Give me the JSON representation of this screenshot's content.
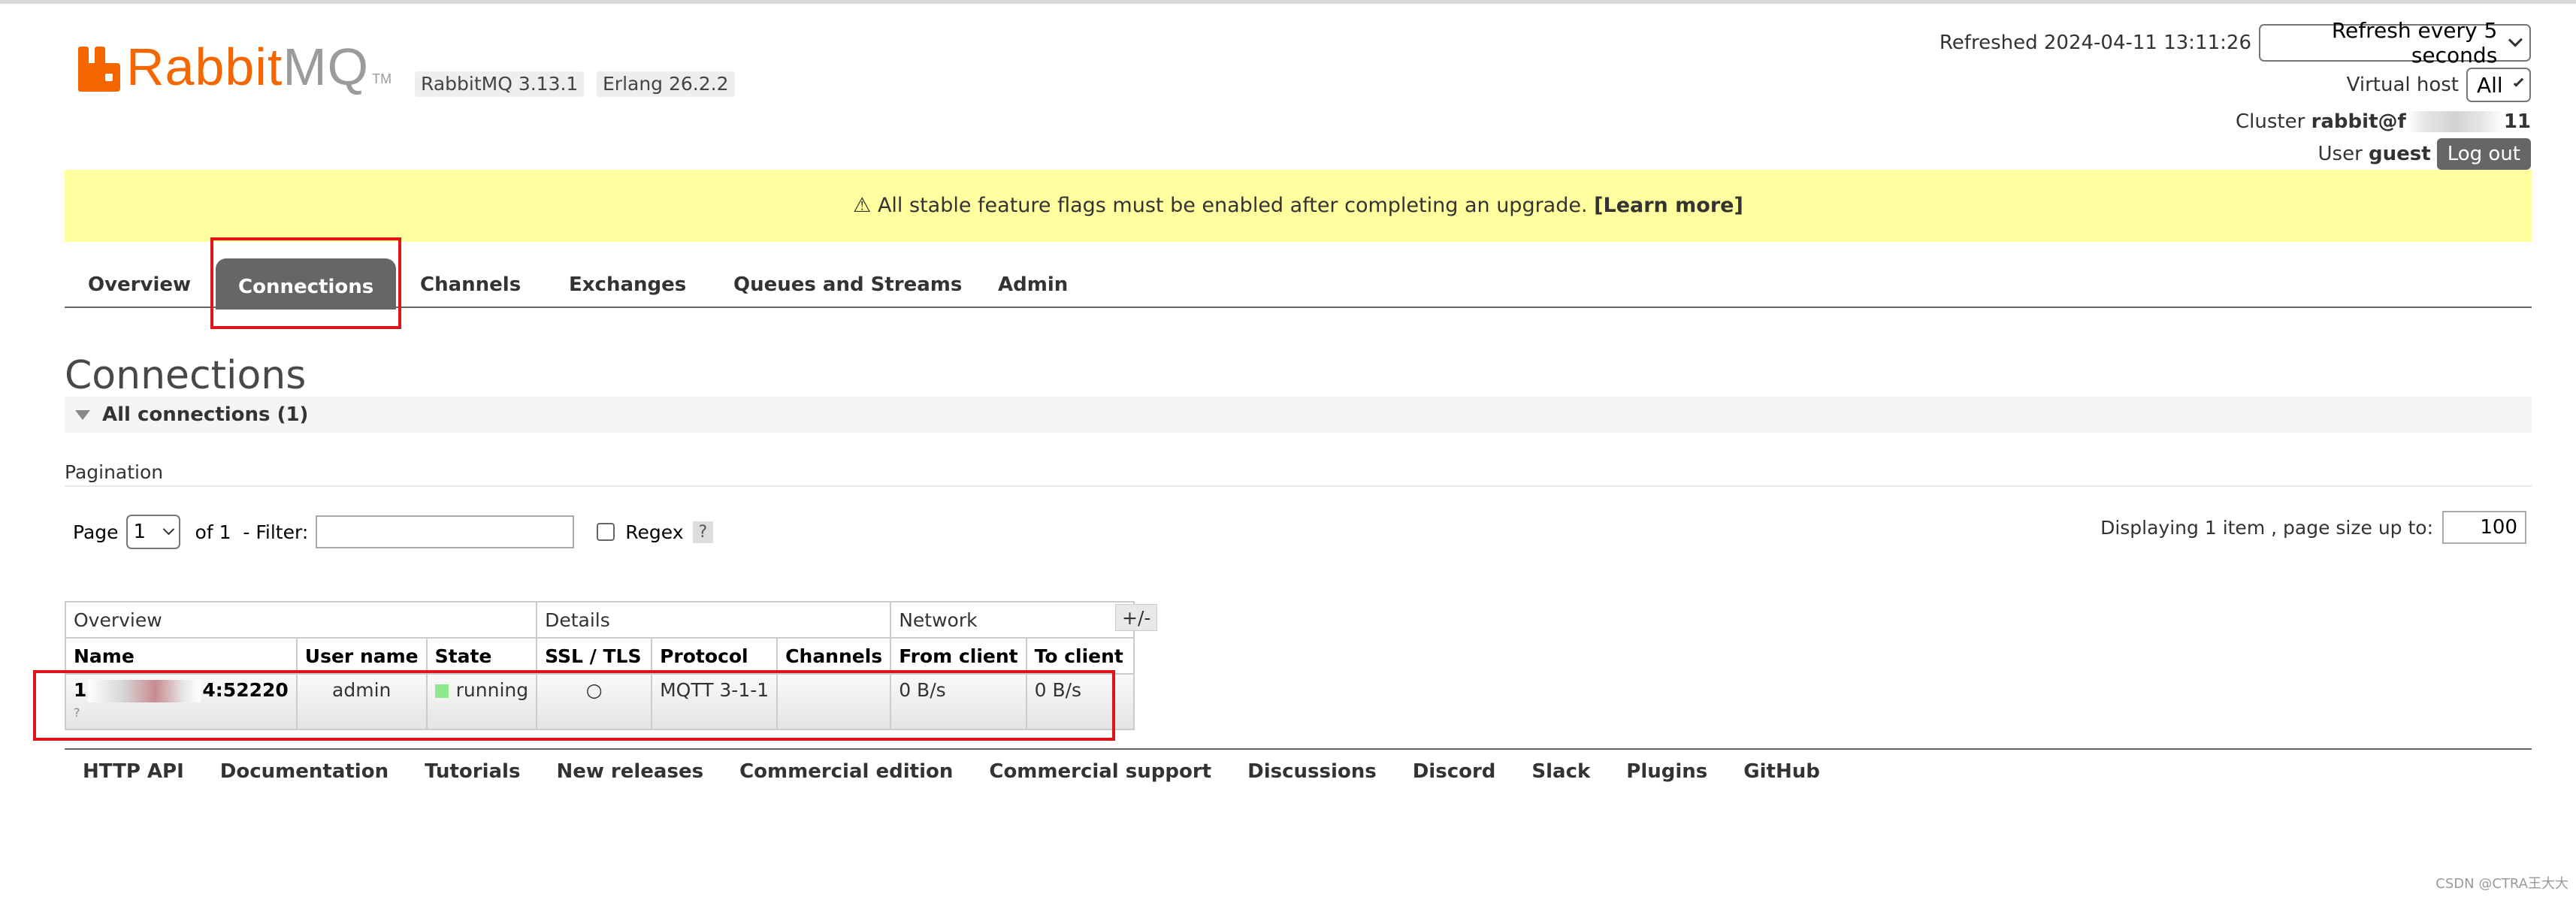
{
  "header": {
    "logo_rabbit": "Rabbit",
    "logo_mq": "MQ",
    "logo_tm": "TM",
    "version": "RabbitMQ 3.13.1",
    "erlang": "Erlang 26.2.2",
    "refreshed_label": "Refreshed 2024-04-11 13:11:26",
    "refresh_select": "Refresh every 5 seconds",
    "vhost_label": "Virtual host",
    "vhost_select": "All",
    "cluster_label": "Cluster",
    "cluster_prefix": "rabbit@f",
    "cluster_suffix": "11",
    "user_label": "User",
    "user_name": "guest",
    "logout": "Log out"
  },
  "banner": {
    "text": "⚠ All stable feature flags must be enabled after completing an upgrade.",
    "link": "[Learn more]"
  },
  "tabs": [
    "Overview",
    "Connections",
    "Channels",
    "Exchanges",
    "Queues and Streams",
    "Admin"
  ],
  "active_tab": "Connections",
  "page_title": "Connections",
  "section": "All connections (1)",
  "pagination": {
    "label": "Pagination",
    "page_label": "Page",
    "page_value": "1",
    "of_label": "of 1",
    "filter_label": "- Filter:",
    "regex_label": "Regex",
    "help": "?",
    "display_label": "Displaying 1 item , page size up to:",
    "page_size": "100"
  },
  "table": {
    "groups": [
      "Overview",
      "Details",
      "Network"
    ],
    "columns": [
      "Name",
      "User name",
      "State",
      "SSL / TLS",
      "Protocol",
      "Channels",
      "From client",
      "To client"
    ],
    "toggle": "+/-",
    "row": {
      "name_prefix": "1",
      "name_suffix": "4:52220",
      "name_sub": "?",
      "user": "admin",
      "state": "running",
      "ssl": "○",
      "protocol": "MQTT 3-1-1",
      "channels": "",
      "from_client": "0 B/s",
      "to_client": "0 B/s"
    }
  },
  "footer": [
    "HTTP API",
    "Documentation",
    "Tutorials",
    "New releases",
    "Commercial edition",
    "Commercial support",
    "Discussions",
    "Discord",
    "Slack",
    "Plugins",
    "GitHub"
  ],
  "watermark": "CSDN @CTRA王大大",
  "colors": {
    "brand_orange": "#f46600",
    "banner_yellow": "#ffffa0",
    "tab_active": "#666666",
    "highlight_red": "#e0151b",
    "running_green": "#8ee88e"
  }
}
